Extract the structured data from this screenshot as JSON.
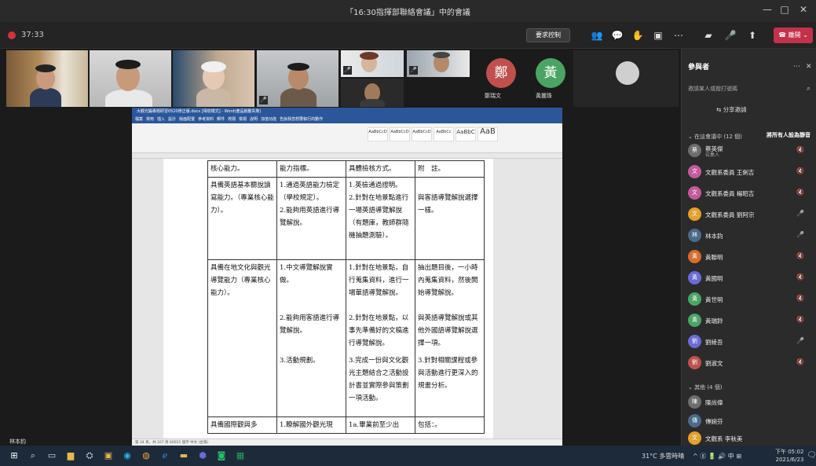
{
  "window": {
    "title": "「16:30指揮部聯絡會議」中的會議",
    "minimize": "—",
    "maximize": "□",
    "close": "✕"
  },
  "toolbar": {
    "timer": "37:33",
    "request_control": "要求控制",
    "leave": "離開"
  },
  "videos": [
    {
      "name": "",
      "mic": "🎤"
    },
    {
      "name": "",
      "mic": "🎤"
    },
    {
      "name": "",
      "mic": "🎤"
    },
    {
      "name": "",
      "mic": "🎤"
    },
    {
      "name": "",
      "mic": "🎤"
    },
    {
      "name": "",
      "mic": "🎤"
    }
  ],
  "avatars": [
    {
      "initial": "鄭",
      "name": "鄭瑞文",
      "color": "#c0504d"
    },
    {
      "initial": "黃",
      "name": "黃麗珠",
      "color": "#4aa564"
    }
  ],
  "word": {
    "title": "大觀光鍛專題研習0520修正版.docx [相容模式] - Word(產品啟動失敗)",
    "tabs": [
      "檔案",
      "常用",
      "插入",
      "設計",
      "版面配置",
      "參考資料",
      "郵件",
      "校閱",
      "檢視",
      "說明",
      "加值功能",
      "告訴我您想要執行的動作"
    ],
    "styles": [
      "AaBbCcD",
      "AaBbCcD",
      "AaBbCcD",
      "AaBbCc",
      "AaBbC",
      "AaB"
    ],
    "statusbar": "第 34 頁，共 107 頁  60015 個字  中文 (台灣)"
  },
  "table": {
    "headers": [
      "核心能力。",
      "能力指標。",
      "具體檢核方式。",
      "附　註。"
    ],
    "rows": [
      {
        "core": "具備英語基本聽說讀寫能力。（專業核心能力）。",
        "indicators": [
          "1.通過英語能力檢定（學校規定）。",
          "2.能夠用英語進行導覽解說。"
        ],
        "methods": [
          "1.英檢通過證明。",
          "2.針對在地景點進行一場英語導覽解說（有題庫，教師群隨機抽題測驗）。"
        ],
        "notes": [
          "",
          "與客語導覽解說選擇一樣。"
        ]
      },
      {
        "core": "具備在地文化與觀光導覽能力（專業核心能力）。",
        "indicators": [
          "1.中文導覽解說實做。",
          "2.能夠用客語進行導覽解說。",
          "3.活動規劃。"
        ],
        "methods": [
          "1.針對在地景點，自行蒐集資料，進行一場華語導覽解說。",
          "2.針對在地景點，以事先準備好的文稿進行導覽解說。",
          "3.完成一份與文化觀光主題結合之活動設計書並實際參與策劃一項活動。"
        ],
        "notes": [
          "抽出題目後，一小時內蒐集資料，然後開始導覽解說。",
          "與英語導覽解說或其他外國語導覽解說選擇一項。",
          "3.針對相關課程或參與活動進行更深入的規畫分析。"
        ]
      },
      {
        "core": "具備國際觀與多",
        "indicators": [
          "1.瞭解國外觀光現"
        ],
        "methods": [
          "1a.畢業前至少出"
        ],
        "notes": [
          "包括：。"
        ]
      }
    ]
  },
  "sharer": "林本鈞",
  "panel": {
    "title": "參與者",
    "search_placeholder": "邀請某人或撥打號碼",
    "share_invite": "分享邀請",
    "in_meeting": "在這會議中 (12 個)",
    "mute_all": "將所有人設為靜音",
    "participants": [
      {
        "name": "蔡英傑",
        "sub": "召集人",
        "initial": "蔡",
        "color": "#6d6d6d",
        "mic": "🔇"
      },
      {
        "name": "文觀系委員 王俐吉",
        "sub": "",
        "initial": "文",
        "color": "#c35a9b",
        "mic": "🔇"
      },
      {
        "name": "文觀系委員 楊昭吉",
        "sub": "",
        "initial": "文",
        "color": "#c35a9b",
        "mic": "🔇"
      },
      {
        "name": "文觀系委員 劉阿宗",
        "sub": "",
        "initial": "文",
        "color": "#e3a02c",
        "mic": "🎤"
      },
      {
        "name": "林本鈞",
        "sub": "",
        "initial": "林",
        "color": "#4a6b8a",
        "mic": "🎤"
      },
      {
        "name": "黃聯明",
        "sub": "",
        "initial": "黃",
        "color": "#d96b2c",
        "mic": "🔇"
      },
      {
        "name": "黃國明",
        "sub": "",
        "initial": "黃",
        "color": "#6b6bd6",
        "mic": "🔇"
      },
      {
        "name": "黃世明",
        "sub": "",
        "initial": "黃",
        "color": "#4aa564",
        "mic": "🔇"
      },
      {
        "name": "黃瑞鈴",
        "sub": "",
        "initial": "黃",
        "color": "#4aa564",
        "mic": "🔇"
      },
      {
        "name": "劉綾吾",
        "sub": "",
        "initial": "劉",
        "color": "#6b6bd6",
        "mic": "🎤"
      },
      {
        "name": "劉淑文",
        "sub": "",
        "initial": "劉",
        "color": "#c0504d",
        "mic": "🔇"
      }
    ],
    "others_header": "其他 (4 個)",
    "others": [
      {
        "name": "陳尚偉",
        "initial": "陳",
        "color": "#6d6d6d"
      },
      {
        "name": "傳婉芬",
        "initial": "傳",
        "color": "#4a6b8a"
      },
      {
        "name": "文觀系 李秋美",
        "initial": "文",
        "color": "#e3a02c"
      }
    ]
  },
  "taskbar": {
    "weather": "31°C 多雲時晴",
    "tray": "^ ⓖ 🔋 🔊 中 ⊞",
    "time": "下午 05:02",
    "date": "2021/6/23",
    "notif": "🗨"
  }
}
